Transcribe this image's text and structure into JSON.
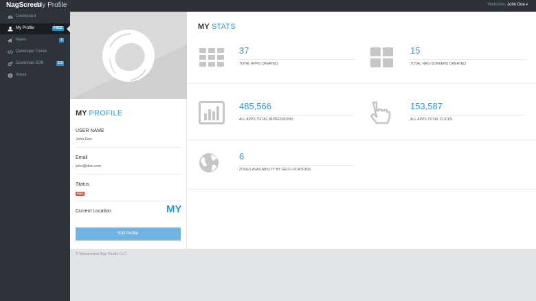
{
  "topbar": {
    "brand": "NagScreen",
    "page_title": "My Profile",
    "welcome_prefix": "Welcome,",
    "user": "John Doe",
    "caret": "▾"
  },
  "sidebar": {
    "items": [
      {
        "label": "Dashboard",
        "icon": "dashboard-icon"
      },
      {
        "label": "My Profile",
        "icon": "user-icon",
        "badge": "FREE",
        "active": true
      },
      {
        "label": "News",
        "icon": "megaphone-icon",
        "badge": "2"
      },
      {
        "label": "Developer Guide",
        "icon": "code-icon"
      },
      {
        "label": "Download SDK",
        "icon": "cogs-icon",
        "badge": "2.0"
      },
      {
        "label": "About",
        "icon": "info-icon"
      }
    ]
  },
  "profile": {
    "heading_prefix": "MY",
    "heading_accent": "PROFILE",
    "username_label": "USER NAME",
    "username_value": "John Doe",
    "email_label": "Email",
    "email_value": "john@doe.com",
    "status_label": "Status",
    "status_value": "PAID",
    "location_label": "Current Location",
    "location_value": "MY",
    "edit_button": "Edit Profile"
  },
  "stats": {
    "heading_prefix": "MY",
    "heading_accent": "STATS",
    "items": [
      {
        "value": "37",
        "label": "TOTAL APPS CREATED",
        "icon": "grid-icon"
      },
      {
        "value": "15",
        "label": "TOTAL NAG-SCREENS CREATED",
        "icon": "tiles-icon"
      },
      {
        "value": "485,566",
        "label": "ALL APPS TOTAL IMPRESSIONS",
        "icon": "bar-chart-icon"
      },
      {
        "value": "153,587",
        "label": "ALL APPS TOTAL CLICKS",
        "icon": "hand-pointer-icon"
      },
      {
        "value": "6",
        "label": "ZONES AVAILABILITY BY GEO-LOCATIONS",
        "icon": "globe-icon"
      }
    ]
  },
  "footer": {
    "text": "© Mastermind App Studio LLC."
  },
  "colors": {
    "accent": "#2b9bd6",
    "sidebar_bg": "#2d3338",
    "topbar_bg": "#2c3237",
    "badge_blue": "#2b8fcf",
    "badge_red": "#d9534f",
    "button_bg": "#6fb4e3"
  }
}
